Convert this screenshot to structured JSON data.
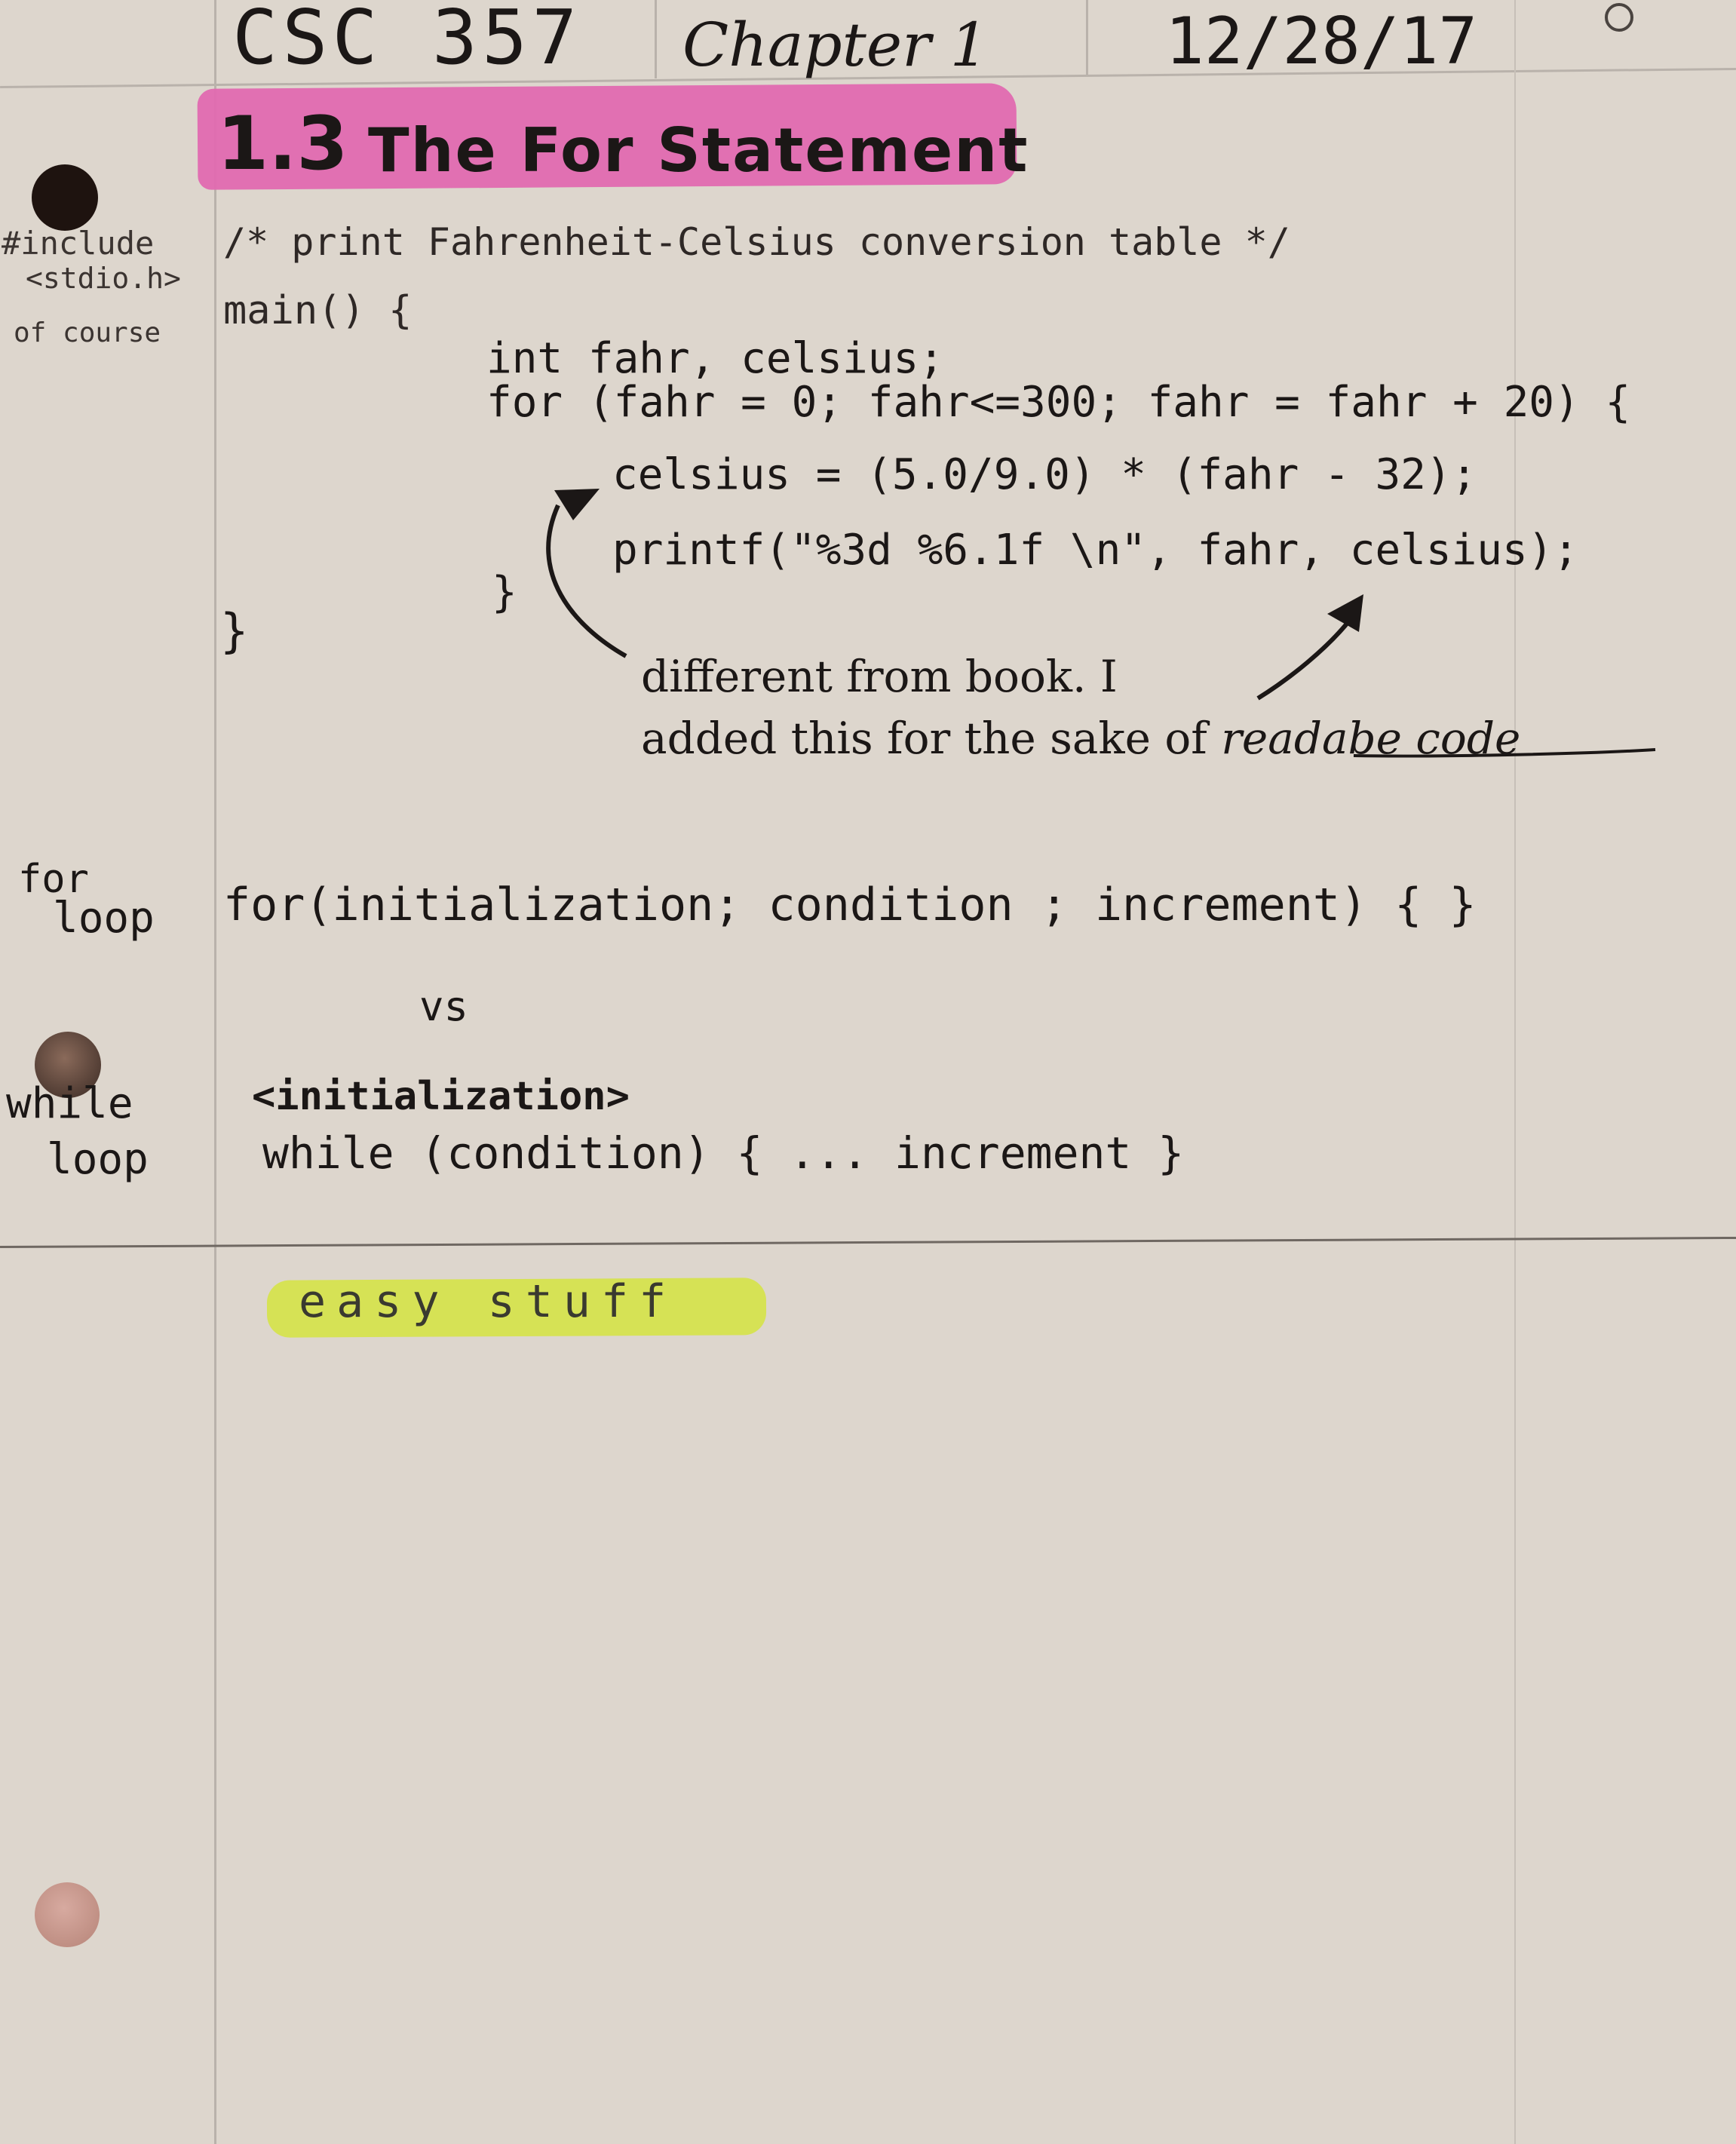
{
  "header": {
    "course": "CSC 357",
    "chapter": "Chapter 1",
    "date": "12/28/17"
  },
  "title": {
    "number": "1.3",
    "text": "The For Statement",
    "highlight_color": "#e06ab0"
  },
  "margin_notes": {
    "include": [
      "#include",
      "<stdio.h>",
      "of course"
    ],
    "for_loop": [
      "for",
      "loop"
    ],
    "while_loop": [
      "while",
      "loop"
    ]
  },
  "code": {
    "comment": "/* print Fahrenheit-Celsius conversion table */",
    "main": "main() {",
    "decl": "int fahr, celsius;",
    "for_line": "for (fahr = 0; fahr<=300; fahr = fahr + 20) {",
    "celsius_line": "celsius = (5.0/9.0) * (fahr - 32);",
    "printf_line": "printf(\"%3d %6.1f \\n\", fahr, celsius);",
    "inner_close": "}",
    "outer_close": "}"
  },
  "annotation": {
    "line1": "different from book. I",
    "line2_pre": "added this for the sake of ",
    "line2_underlined": "readabe code"
  },
  "syntax": {
    "for_syntax": "for(initialization; condition ; increment) {  }",
    "vs": "vs",
    "while_init": "<initialization>",
    "while_syntax": "while (condition) { ... increment }"
  },
  "summary": {
    "text": "easy stuff",
    "highlight_color": "#d6e255"
  }
}
